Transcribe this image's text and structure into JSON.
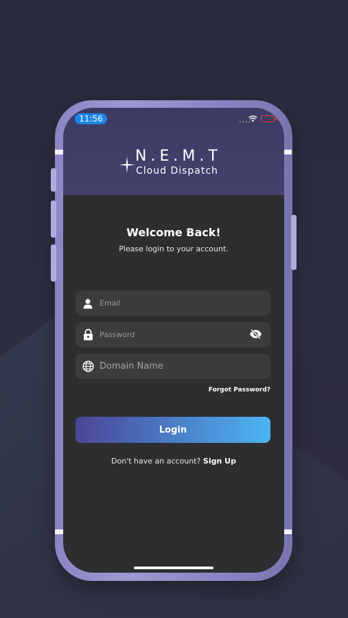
{
  "status_bar": {
    "time": "11:56"
  },
  "logo": {
    "title": "N.E.M.T",
    "subtitle": "Cloud Dispatch"
  },
  "welcome": {
    "title": "Welcome Back!",
    "subtitle": "Please login to your account."
  },
  "form": {
    "email_placeholder": "Email",
    "password_placeholder": "Password",
    "domain_placeholder": "Domain Name",
    "forgot_label": "Forgot Password?",
    "login_label": "Login"
  },
  "signup": {
    "prompt": "Don't have an account?",
    "link_label": "Sign Up"
  },
  "colors": {
    "accent_start": "#4b4596",
    "accent_end": "#4db4f3",
    "time_pill": "#1b86e8",
    "battery": "#e1443b"
  }
}
